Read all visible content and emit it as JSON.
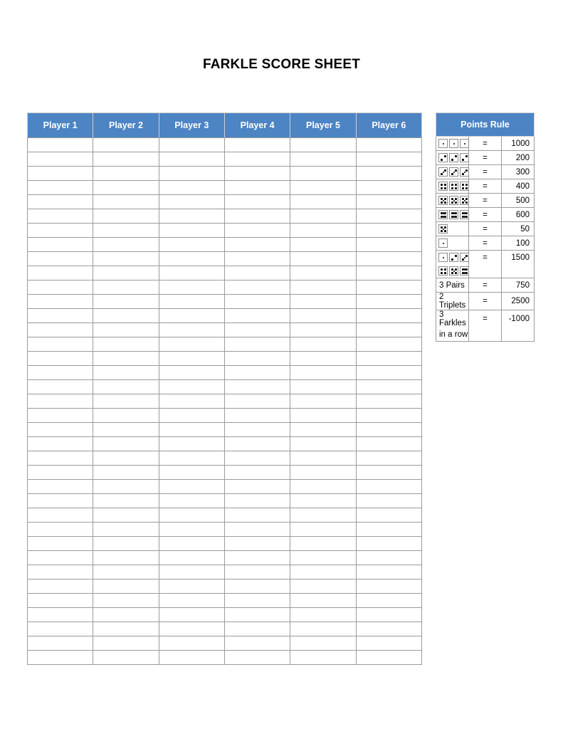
{
  "document": {
    "title": "FARKLE SCORE SHEET"
  },
  "theme": {
    "header_blue": "#4c84c4",
    "header_text": "#ffffff",
    "grid_line": "#9b9b9b",
    "negative_red": "#ff0000",
    "page_background": "#ffffff"
  },
  "score_table": {
    "columns": [
      {
        "label": "Player 1"
      },
      {
        "label": "Player 2"
      },
      {
        "label": "Player 3"
      },
      {
        "label": "Player 4"
      },
      {
        "label": "Player 5"
      },
      {
        "label": "Player 6"
      }
    ],
    "row_count": 37,
    "rows_are_blank": true
  },
  "points_panel": {
    "header": "Points Rule",
    "equals_sign": "=",
    "rules": [
      {
        "id": "three-ones",
        "kind": "dice",
        "dice": [
          1,
          1,
          1
        ],
        "equals": "=",
        "value": "1000",
        "negative": false
      },
      {
        "id": "three-twos",
        "kind": "dice",
        "dice": [
          2,
          2,
          2
        ],
        "equals": "=",
        "value": "200",
        "negative": false
      },
      {
        "id": "three-threes",
        "kind": "dice",
        "dice": [
          3,
          3,
          3
        ],
        "equals": "=",
        "value": "300",
        "negative": false
      },
      {
        "id": "three-fours",
        "kind": "dice",
        "dice": [
          4,
          4,
          4
        ],
        "equals": "=",
        "value": "400",
        "negative": false
      },
      {
        "id": "three-fives",
        "kind": "dice",
        "dice": [
          5,
          5,
          5
        ],
        "equals": "=",
        "value": "500",
        "negative": false
      },
      {
        "id": "three-sixes",
        "kind": "dice",
        "dice": [
          6,
          6,
          6
        ],
        "equals": "=",
        "value": "600",
        "negative": false
      },
      {
        "id": "single-five",
        "kind": "dice",
        "dice": [
          5
        ],
        "equals": "=",
        "value": "50",
        "negative": false
      },
      {
        "id": "single-one",
        "kind": "dice",
        "dice": [
          1
        ],
        "equals": "=",
        "value": "100",
        "negative": false
      },
      {
        "id": "straight",
        "kind": "dice-two-line",
        "dice": [
          1,
          2,
          3
        ],
        "dice_line2": [
          4,
          5,
          6
        ],
        "equals": "=",
        "value": "1500",
        "negative": false
      },
      {
        "id": "three-pairs",
        "kind": "text",
        "label": "3 Pairs",
        "equals": "=",
        "value": "750",
        "negative": false
      },
      {
        "id": "two-triplets",
        "kind": "text",
        "label": "2 Triplets",
        "equals": "=",
        "value": "2500",
        "negative": false
      },
      {
        "id": "three-farkles",
        "kind": "text-two-line",
        "label": "3 Farkles",
        "label_line2": "in a row",
        "equals": "=",
        "value": "-1000",
        "negative": true
      }
    ]
  }
}
